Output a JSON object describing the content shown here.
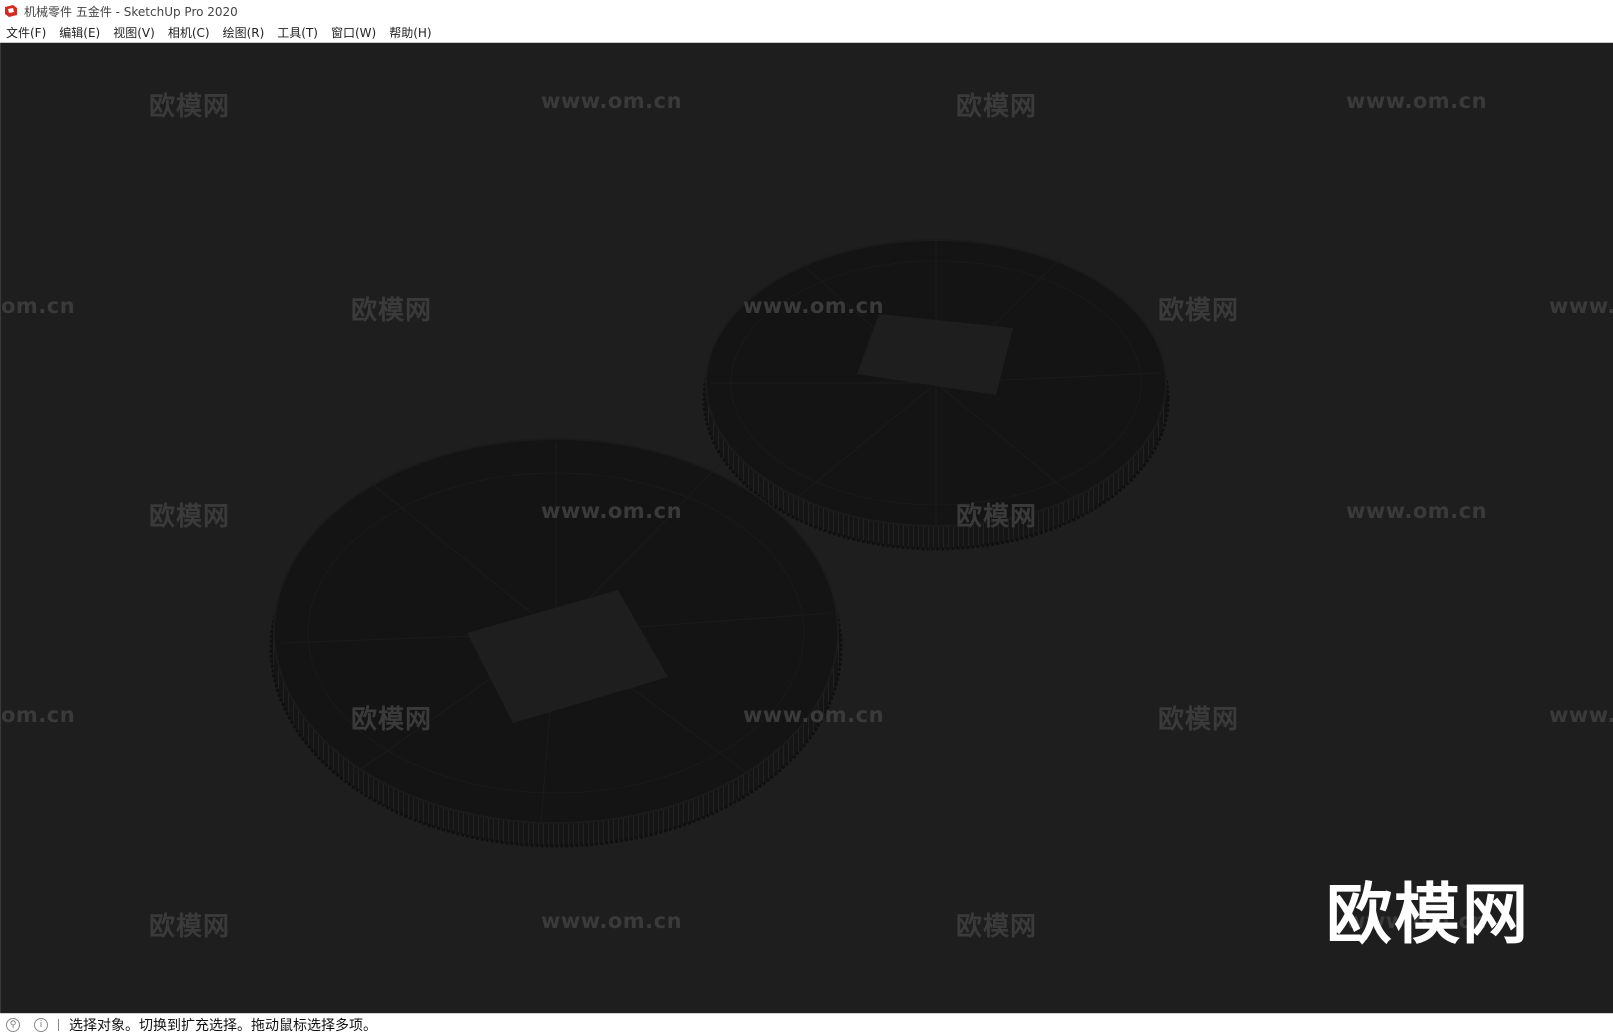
{
  "window": {
    "title": "机械零件 五金件 - SketchUp Pro 2020",
    "icon": "sketchup-logo-icon"
  },
  "menubar": {
    "items": [
      {
        "label": "文件(F)"
      },
      {
        "label": "编辑(E)"
      },
      {
        "label": "视图(V)"
      },
      {
        "label": "相机(C)"
      },
      {
        "label": "绘图(R)"
      },
      {
        "label": "工具(T)"
      },
      {
        "label": "窗口(W)"
      },
      {
        "label": "帮助(H)"
      }
    ]
  },
  "watermark": {
    "brand": "欧模网",
    "url": "www.om.cn",
    "url_partial_left": "om.cn",
    "url_partial_right": "www.",
    "big_logo": "欧模网"
  },
  "statusbar": {
    "icons": [
      "geo-location-icon",
      "info-icon"
    ],
    "message": "选择对象。切换到扩充选择。拖动鼠标选择多项。"
  },
  "colors": {
    "viewport_bg": "#1e1e1e",
    "model_fill": "#141414",
    "hole_fill": "#1e1e1e",
    "watermark": "#3a3a3a"
  }
}
